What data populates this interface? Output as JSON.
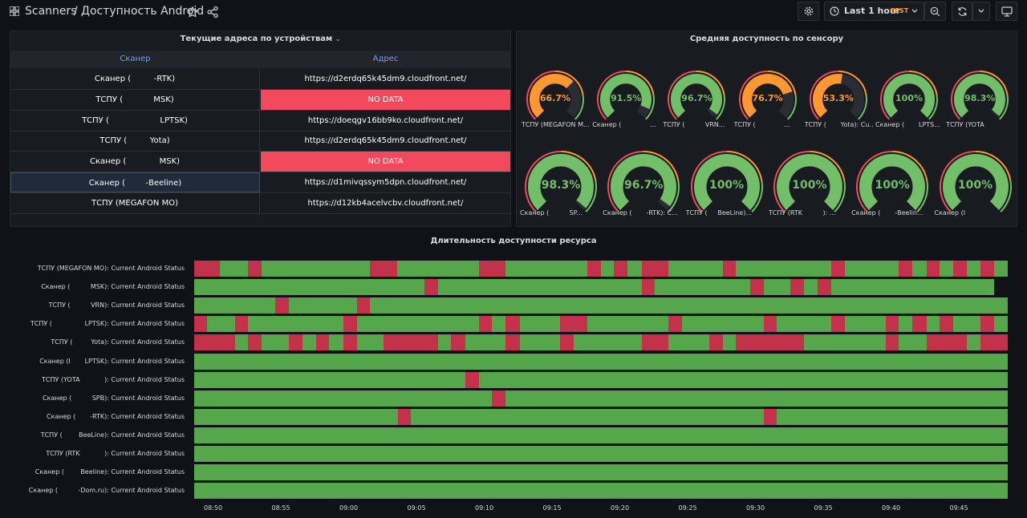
{
  "topbar": {
    "breadcrumb_root": "Scanners",
    "breadcrumb_sep": "/",
    "title": "Доступность Android",
    "time_range": "Last 1 hour",
    "timezone": "EEST"
  },
  "table_panel": {
    "title": "Текущие адреса по устройствам",
    "columns": [
      "Сканер",
      "Адрес"
    ],
    "rows": [
      {
        "scanner": "Сканер (         -RTK)",
        "address": "https://d2erdq65k45dm9.cloudfront.net/",
        "nodata": false
      },
      {
        "scanner": "ТСПУ (            MSK)",
        "address": "NO DATA",
        "nodata": true
      },
      {
        "scanner": "ТСПУ (                    LPTSK)",
        "address": "https://doeqgv16bb9ko.cloudfront.net/",
        "nodata": false
      },
      {
        "scanner": "ТСПУ (         Yota)",
        "address": "https://d2erdq65k45dm9.cloudfront.net/",
        "nodata": false
      },
      {
        "scanner": "Сканер (             MSK)",
        "address": "NO DATA",
        "nodata": true
      },
      {
        "scanner": "Сканер (        -Beeline)",
        "address": "https://d1mivqssym5dpn.cloudfront.net/",
        "nodata": false
      },
      {
        "scanner": "ТСПУ (MEGAFON MO)",
        "address": "https://d12kb4acelvcbv.cloudfront.net/",
        "nodata": false
      }
    ]
  },
  "gauge_panel": {
    "title": "Средняя доступность по сенсору",
    "colors": {
      "green": "#73bf69",
      "orange": "#ff9830",
      "red": "#f2495c",
      "track": "#2a2d33"
    },
    "gauges": [
      {
        "value": 66.7,
        "text": "66.7%",
        "label": "ТСПУ (MEGAFON M...",
        "color": "#ff9830"
      },
      {
        "value": 91.5,
        "text": "91.5%",
        "label": "Сканер (              ...",
        "color": "#73bf69"
      },
      {
        "value": 96.7,
        "text": "96.7%",
        "label": "ТСПУ (          VRN...",
        "color": "#73bf69"
      },
      {
        "value": 76.7,
        "text": "76.7%",
        "label": "ТСПУ (              ...",
        "color": "#ff9830"
      },
      {
        "value": 53.3,
        "text": "53.3%",
        "label": "ТСПУ (       Yota): Cu...",
        "color": "#ff9830"
      },
      {
        "value": 100,
        "text": "100%",
        "label": "Сканер (       LPTS...",
        "color": "#73bf69"
      },
      {
        "value": 98.3,
        "text": "98.3%",
        "label": "ТСПУ (YOTA",
        "color": "#73bf69"
      },
      {
        "value": 98.3,
        "text": "98.3%",
        "label": "Сканер (          SP...",
        "color": "#73bf69"
      },
      {
        "value": 96.7,
        "text": "96.7%",
        "label": "Сканер (       -RTK): C...",
        "color": "#73bf69"
      },
      {
        "value": 100,
        "text": "100%",
        "label": "ТСПУ (     BeeLine)...",
        "color": "#73bf69"
      },
      {
        "value": 100,
        "text": "100%",
        "label": "ТСПУ (RTK          ): ...",
        "color": "#73bf69"
      },
      {
        "value": 100,
        "text": "100%",
        "label": "Сканер (       -Beelin...",
        "color": "#73bf69"
      },
      {
        "value": 100,
        "text": "100%",
        "label": "Сканер (I",
        "color": "#73bf69"
      }
    ]
  },
  "state_panel": {
    "title": "Длительность доступности ресурса",
    "colors": {
      "up": "#56a64b",
      "down": "#c4314b",
      "gap": "#111217"
    },
    "x_start": "08:48:35",
    "x_end": "09:48:35",
    "ticks": [
      "08:50",
      "08:55",
      "09:00",
      "09:05",
      "09:10",
      "09:15",
      "09:20",
      "09:25",
      "09:30",
      "09:35",
      "09:40",
      "09:45"
    ],
    "rows": [
      {
        "label": "ТСПУ (MEGAFON MO): Current Android Status",
        "end": 1.0,
        "down": [
          [
            0.0,
            0.032
          ],
          [
            0.066,
            0.083
          ],
          [
            0.216,
            0.25
          ],
          [
            0.35,
            0.383
          ],
          [
            0.483,
            0.5
          ],
          [
            0.516,
            0.533
          ],
          [
            0.55,
            0.583
          ],
          [
            0.65,
            0.666
          ],
          [
            0.783,
            0.8
          ],
          [
            0.866,
            0.883
          ],
          [
            0.9,
            0.916
          ],
          [
            0.933,
            0.95
          ],
          [
            0.966,
            0.983
          ]
        ]
      },
      {
        "label": "Сканер (          MSK): Current Android Status",
        "end": 0.983,
        "down": [
          [
            0.283,
            0.3
          ],
          [
            0.55,
            0.566
          ],
          [
            0.683,
            0.7
          ],
          [
            0.733,
            0.75
          ],
          [
            0.766,
            0.783
          ]
        ]
      },
      {
        "label": "ТСПУ (          VRN): Current Android Status",
        "end": 1.0,
        "down": [
          [
            0.1,
            0.116
          ],
          [
            0.2,
            0.216
          ]
        ]
      },
      {
        "label": "ТСПУ (                LPTSK): Current Android Status",
        "end": 1.0,
        "down": [
          [
            0.0,
            0.016
          ],
          [
            0.05,
            0.066
          ],
          [
            0.183,
            0.2
          ],
          [
            0.35,
            0.366
          ],
          [
            0.383,
            0.4
          ],
          [
            0.45,
            0.483
          ],
          [
            0.583,
            0.6
          ],
          [
            0.7,
            0.716
          ],
          [
            0.783,
            0.8
          ],
          [
            0.85,
            0.866
          ],
          [
            0.883,
            0.9
          ],
          [
            0.916,
            0.933
          ],
          [
            0.966,
            0.983
          ]
        ]
      },
      {
        "label": "ТСПУ (         Yota): Current Android Status",
        "end": 1.0,
        "down": [
          [
            0.0,
            0.05
          ],
          [
            0.066,
            0.083
          ],
          [
            0.116,
            0.133
          ],
          [
            0.15,
            0.166
          ],
          [
            0.183,
            0.2
          ],
          [
            0.233,
            0.3
          ],
          [
            0.316,
            0.333
          ],
          [
            0.383,
            0.4
          ],
          [
            0.45,
            0.466
          ],
          [
            0.55,
            0.583
          ],
          [
            0.633,
            0.65
          ],
          [
            0.666,
            0.75
          ],
          [
            0.85,
            0.866
          ],
          [
            0.9,
            0.95
          ],
          [
            0.966,
            1.0
          ]
        ]
      },
      {
        "label": "Сканер (I       LPTSK): Current Android Status",
        "end": 1.0,
        "down": []
      },
      {
        "label": "ТСПУ (YOTA            ): Current Android Status",
        "end": 1.0,
        "down": [
          [
            0.333,
            0.35
          ]
        ]
      },
      {
        "label": "Сканер (          SPB): Current Android Status",
        "end": 1.0,
        "down": [
          [
            0.366,
            0.383
          ]
        ]
      },
      {
        "label": "Сканер (       -RTK): Current Android Status",
        "end": 1.0,
        "down": [
          [
            0.25,
            0.266
          ],
          [
            0.7,
            0.716
          ]
        ]
      },
      {
        "label": "ТСПУ (        BeeLine): Current Android Status",
        "end": 1.0,
        "down": []
      },
      {
        "label": "ТСПУ (RTK            ): Current Android Status",
        "end": 1.0,
        "down": []
      },
      {
        "label": "Сканер (        Beeline): Current Android Status",
        "end": 1.0,
        "down": []
      },
      {
        "label": "Сканер (          -Dom.ru): Current Android Status",
        "end": 1.0,
        "down": []
      }
    ]
  }
}
